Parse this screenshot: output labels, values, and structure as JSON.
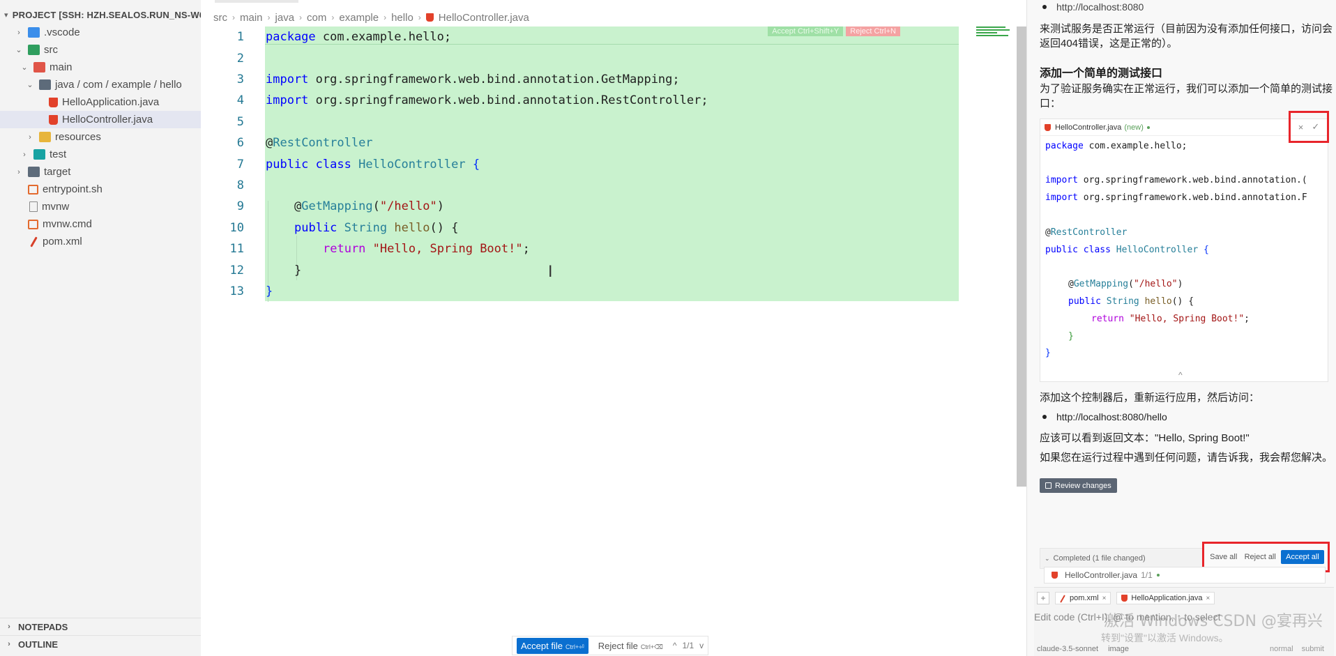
{
  "sidebar": {
    "project_title": "PROJECT [SSH: HZH.SEALOS.RUN_NS-W6H...",
    "tree": [
      {
        "label": ".vscode",
        "depth": 1,
        "chevron": "right",
        "icon": "folder-blue"
      },
      {
        "label": "src",
        "depth": 1,
        "chevron": "down",
        "icon": "folder-green"
      },
      {
        "label": "main",
        "depth": 2,
        "chevron": "down",
        "icon": "folder-red"
      },
      {
        "label": "java / com / example / hello",
        "depth": 3,
        "chevron": "down",
        "icon": "folder-gray"
      },
      {
        "label": "HelloApplication.java",
        "depth": 4,
        "chevron": "",
        "icon": "java"
      },
      {
        "label": "HelloController.java",
        "depth": 4,
        "chevron": "",
        "icon": "java",
        "selected": true
      },
      {
        "label": "resources",
        "depth": 3,
        "chevron": "right",
        "icon": "folder-yellow"
      },
      {
        "label": "test",
        "depth": 2,
        "chevron": "right",
        "icon": "folder-teal"
      },
      {
        "label": "target",
        "depth": 1,
        "chevron": "right",
        "icon": "folder-gray"
      },
      {
        "label": "entrypoint.sh",
        "depth": 1,
        "chevron": "",
        "icon": "shell"
      },
      {
        "label": "mvnw",
        "depth": 1,
        "chevron": "",
        "icon": "doc"
      },
      {
        "label": "mvnw.cmd",
        "depth": 1,
        "chevron": "",
        "icon": "shell"
      },
      {
        "label": "pom.xml",
        "depth": 1,
        "chevron": "",
        "icon": "xml"
      }
    ],
    "notepads": "NOTEPADS",
    "outline": "OUTLINE"
  },
  "editor": {
    "breadcrumb": [
      "src",
      "main",
      "java",
      "com",
      "example",
      "hello",
      "HelloController.java"
    ],
    "inline_accept": "Accept Ctrl+Shift+Y",
    "inline_reject": "Reject Ctrl+N",
    "line_numbers": [
      "1",
      "2",
      "3",
      "4",
      "5",
      "6",
      "7",
      "8",
      "9",
      "10",
      "11",
      "12",
      "13"
    ],
    "code": {
      "l1_kw": "package",
      "l1_rest": " com.example.hello;",
      "l3_kw": "import",
      "l3_rest": " org.springframework.web.bind.annotation.GetMapping;",
      "l4_kw": "import",
      "l4_rest": " org.springframework.web.bind.annotation.RestController;",
      "l6_at": "@",
      "l6_ann": "RestController",
      "l7_kw": "public class",
      "l7_sp": " ",
      "l7_type": "HelloController",
      "l7_brace": " {",
      "l9_at": "@",
      "l9_ann": "GetMapping",
      "l9_paren": "(",
      "l9_str": "\"/hello\"",
      "l9_close": ")",
      "l10_kw": "public",
      "l10_sp": " ",
      "l10_type": "String",
      "l10_sp2": " ",
      "l10_fn": "hello",
      "l10_rest": "() {",
      "l11_kw": "return",
      "l11_sp": " ",
      "l11_str": "\"Hello, Spring Boot!\"",
      "l11_end": ";",
      "l12": "}",
      "l13": "}"
    },
    "accept_file": "Accept file",
    "accept_file_key": "Ctrl+⏎",
    "reject_file": "Reject file",
    "reject_file_key": "Ctrl+⌫",
    "nav_up": "^",
    "nav_count": "1/1",
    "nav_down": "v"
  },
  "chat": {
    "top_bullet": "http://localhost:8080",
    "para1": "来测试服务是否正常运行（目前因为没有添加任何接口，访问会返回404错误，这是正常的）。",
    "heading": "添加一个简单的测试接口",
    "para2": "为了验证服务确实在正常运行，我们可以添加一个简单的测试接口：",
    "card": {
      "filename": "HelloController.java",
      "tag": "(new)",
      "reject_icon": "×",
      "accept_icon": "✓",
      "lines": {
        "c1_kw": "package",
        "c1_rest": " com.example.hello;",
        "c3_kw": "import",
        "c3_rest": " org.springframework.web.bind.annotation.(",
        "c4_kw": "import",
        "c4_rest": " org.springframework.web.bind.annotation.F",
        "c6_at": "@",
        "c6_ann": "RestController",
        "c7_kw": "public class",
        "c7_sp": " ",
        "c7_type": "HelloController",
        "c7_rest": " {",
        "c9_at": "@",
        "c9_ann": "GetMapping",
        "c9_p": "(",
        "c9_str": "\"/hello\"",
        "c9_c": ")",
        "c10_kw": "public",
        "c10_sp": " ",
        "c10_type": "String",
        "c10_sp2": " ",
        "c10_fn": "hello",
        "c10_rest": "() {",
        "c11_kw": "return",
        "c11_sp": " ",
        "c11_str": "\"Hello, Spring Boot!\"",
        "c11_end": ";",
        "c12": "}",
        "c13": "}"
      },
      "collapse": "^"
    },
    "para3": "添加这个控制器后，重新运行应用，然后访问：",
    "bullet2": "http://localhost:8080/hello",
    "para4": "应该可以看到返回文本：\"Hello, Spring Boot!\"",
    "para5": "如果您在运行过程中遇到任何问题，请告诉我，我会帮您解决。",
    "review_changes": "Review changes",
    "completed": "Completed (1 file changed)",
    "save_all": "Save all",
    "reject_all": "Reject all",
    "accept_all": "Accept all",
    "changed_file": "HelloController.java",
    "changed_count": "1/1",
    "composer": {
      "add": "+",
      "ctx1": "pom.xml",
      "ctx2": "HelloApplication.java",
      "close": "×",
      "placeholder": "Edit code (Ctrl+I), @ to mention, ↑ to select",
      "watermark": "激活 Windows    CSDN @宴再兴",
      "watermark2": "转到\"设置\"以激活 Windows。",
      "model": "claude-3.5-sonnet",
      "image": "image",
      "mode": "normal",
      "submit": "submit"
    }
  },
  "colors": {
    "added_bg": "#c9f2ce",
    "accent_blue": "#0a6fd0",
    "highlight_red": "#e8252b"
  }
}
